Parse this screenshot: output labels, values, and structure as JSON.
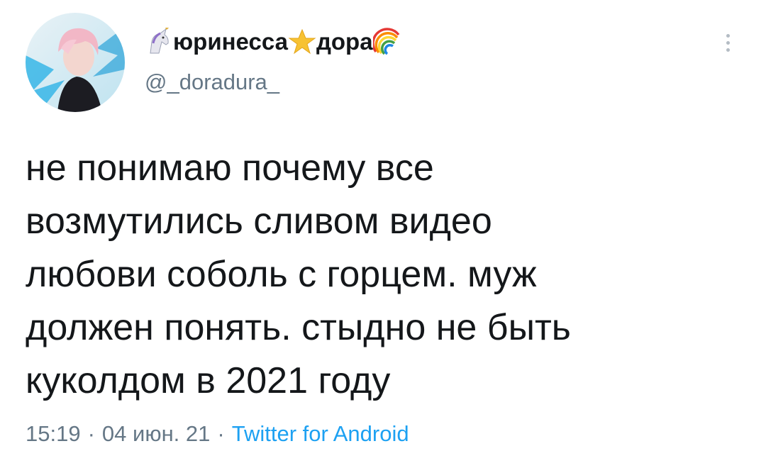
{
  "author": {
    "display_name_part1": "юринесса",
    "display_name_part2": "дора",
    "emoji_1": "unicorn-emoji",
    "emoji_2": "star-emoji",
    "emoji_3": "rainbow-emoji",
    "handle": "@_doradura_"
  },
  "tweet": {
    "text": "не понимаю почему все\nвозмутились сливом видео\nлюбови соболь с горцем. муж\nдолжен понять. стыдно не быть\nкуколдом в 2021 году",
    "time": "15:19",
    "date": "04 июн. 21",
    "separator": "·",
    "source": "Twitter for Android"
  },
  "colors": {
    "primary_text": "#14171a",
    "secondary_text": "#657786",
    "link": "#1da1f2"
  }
}
